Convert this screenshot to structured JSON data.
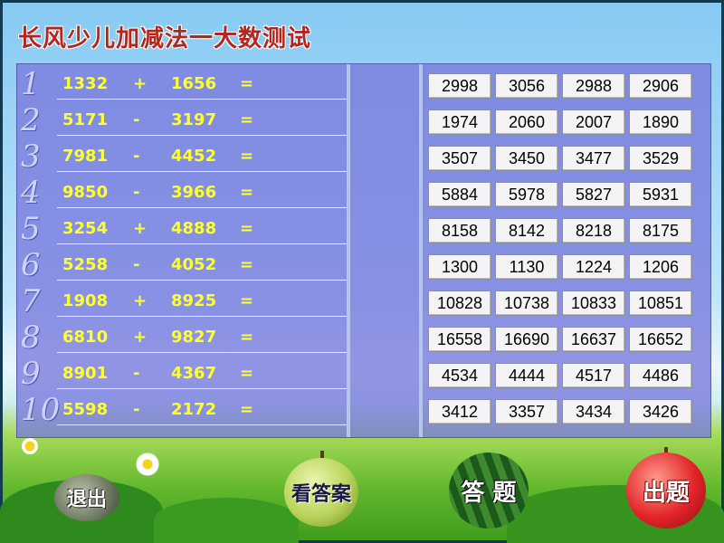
{
  "title": "长风少儿加减法一大数测试",
  "questions": [
    {
      "num": "1",
      "a": "1332",
      "op": "+",
      "b": "1656",
      "eq": "=",
      "choices": [
        "2998",
        "3056",
        "2988",
        "2906"
      ]
    },
    {
      "num": "2",
      "a": "5171",
      "op": "-",
      "b": "3197",
      "eq": "=",
      "choices": [
        "1974",
        "2060",
        "2007",
        "1890"
      ]
    },
    {
      "num": "3",
      "a": "7981",
      "op": "-",
      "b": "4452",
      "eq": "=",
      "choices": [
        "3507",
        "3450",
        "3477",
        "3529"
      ]
    },
    {
      "num": "4",
      "a": "9850",
      "op": "-",
      "b": "3966",
      "eq": "=",
      "choices": [
        "5884",
        "5978",
        "5827",
        "5931"
      ]
    },
    {
      "num": "5",
      "a": "3254",
      "op": "+",
      "b": "4888",
      "eq": "=",
      "choices": [
        "8158",
        "8142",
        "8218",
        "8175"
      ]
    },
    {
      "num": "6",
      "a": "5258",
      "op": "-",
      "b": "4052",
      "eq": "=",
      "choices": [
        "1300",
        "1130",
        "1224",
        "1206"
      ]
    },
    {
      "num": "7",
      "a": "1908",
      "op": "+",
      "b": "8925",
      "eq": "=",
      "choices": [
        "10828",
        "10738",
        "10833",
        "10851"
      ]
    },
    {
      "num": "8",
      "a": "6810",
      "op": "+",
      "b": "9827",
      "eq": "=",
      "choices": [
        "16558",
        "16690",
        "16637",
        "16652"
      ]
    },
    {
      "num": "9",
      "a": "8901",
      "op": "-",
      "b": "4367",
      "eq": "=",
      "choices": [
        "4534",
        "4444",
        "4517",
        "4486"
      ]
    },
    {
      "num": "10",
      "a": "5598",
      "op": "-",
      "b": "2172",
      "eq": "=",
      "choices": [
        "3412",
        "3357",
        "3434",
        "3426"
      ]
    }
  ],
  "buttons": {
    "exit": "退出",
    "show_answer": "看答案",
    "answer": "答 题",
    "new_questions": "出题"
  },
  "colors": {
    "title": "#b3261e",
    "question_text": "#ffff2b",
    "panel": "#7878dc"
  }
}
